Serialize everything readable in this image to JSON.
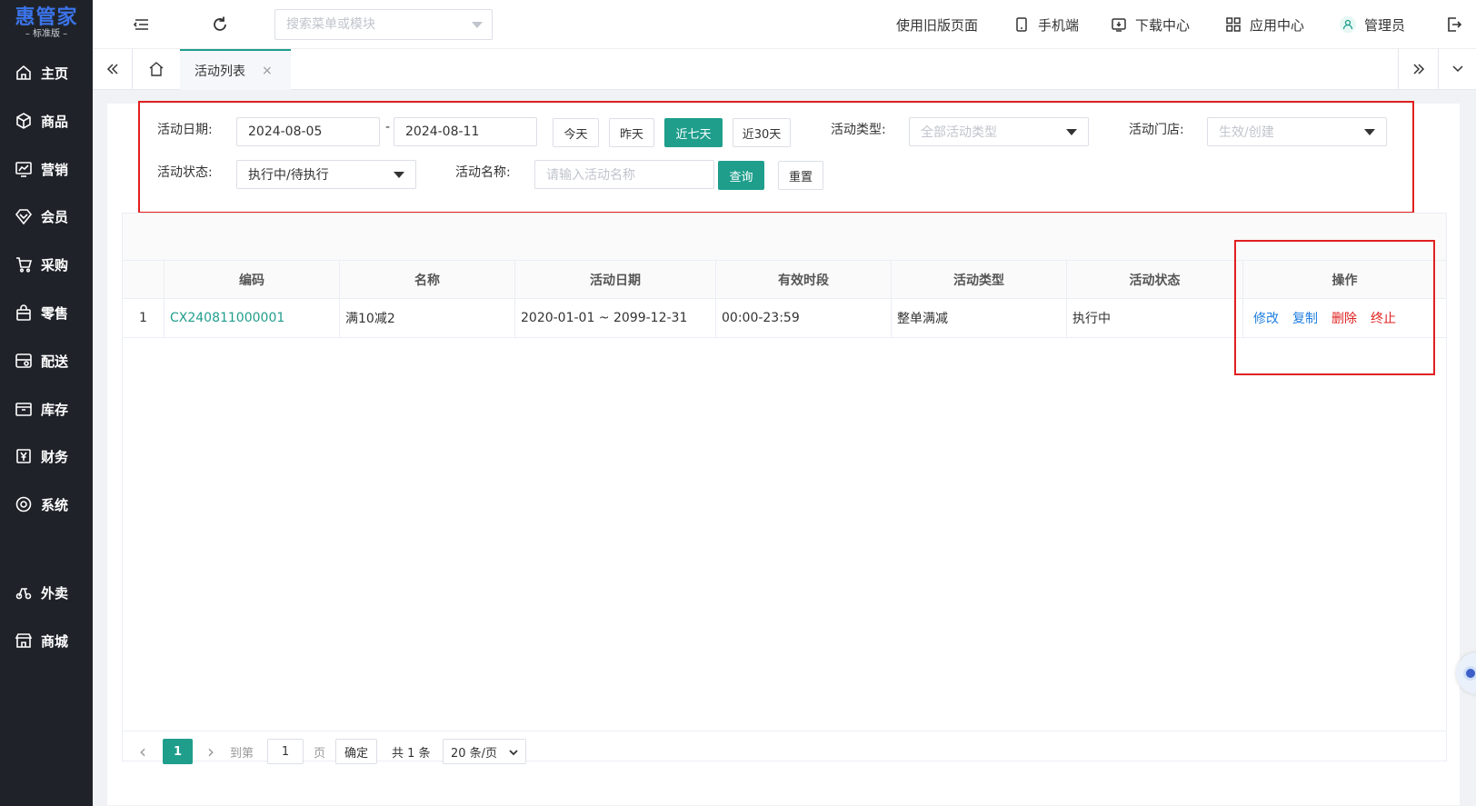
{
  "app": {
    "brand": "惠管家",
    "edition": "– 标准版 –"
  },
  "sidebar": {
    "items": [
      {
        "label": "主页",
        "icon": "home-icon"
      },
      {
        "label": "商品",
        "icon": "box-icon"
      },
      {
        "label": "营销",
        "icon": "chart-icon"
      },
      {
        "label": "会员",
        "icon": "diamond-icon"
      },
      {
        "label": "采购",
        "icon": "cart-icon"
      },
      {
        "label": "零售",
        "icon": "bag-icon"
      },
      {
        "label": "配送",
        "icon": "truck-icon"
      },
      {
        "label": "库存",
        "icon": "archive-icon"
      },
      {
        "label": "财务",
        "icon": "yen-icon"
      },
      {
        "label": "系统",
        "icon": "settings-icon"
      },
      {
        "label": "外卖",
        "icon": "scooter-icon"
      },
      {
        "label": "商城",
        "icon": "store-icon"
      }
    ]
  },
  "topbar": {
    "menu_search_placeholder": "搜索菜单或模块",
    "old_version": "使用旧版页面",
    "mobile": "手机端",
    "downloads": "下载中心",
    "apps": "应用中心",
    "user": "管理员"
  },
  "tabs": {
    "active_label": "活动列表",
    "close": "×"
  },
  "filter": {
    "date_label": "活动日期:",
    "date_start": "2024-08-05",
    "date_sep": "-",
    "date_end": "2024-08-11",
    "btn_today": "今天",
    "btn_yesterday": "昨天",
    "btn_7days": "近七天",
    "btn_30days": "近30天",
    "type_label": "活动类型:",
    "type_value": "全部活动类型",
    "store_label": "活动门店:",
    "store_value": "生效/创建",
    "status_label": "活动状态:",
    "status_value": "执行中/待执行",
    "name_label": "活动名称:",
    "name_placeholder": "请输入活动名称",
    "btn_search": "查询",
    "btn_reset": "重置"
  },
  "table": {
    "columns": [
      "编码",
      "名称",
      "活动日期",
      "有效时段",
      "活动类型",
      "活动状态",
      "操作"
    ],
    "rows": [
      {
        "index": "1",
        "code": "CX240811000001",
        "name": "满10减2",
        "date": "2020-01-01 ~ 2099-12-31",
        "period": "00:00-23:59",
        "type": "整单满减",
        "status": "执行中",
        "actions": {
          "edit": "修改",
          "copy": "复制",
          "delete": "删除",
          "stop": "终止"
        }
      }
    ]
  },
  "pager": {
    "prev": "‹",
    "current": "1",
    "next": "›",
    "goto_label": "到第",
    "goto_value": "1",
    "page_unit": "页",
    "confirm": "确定",
    "total": "共 1 条",
    "page_size": "20 条/页"
  },
  "colors": {
    "accent": "#1f9e8c",
    "sidebar_bg": "#1f2329",
    "link_blue": "#1f7ee0",
    "danger_red": "#e02020",
    "highlight_box": "#e02020"
  }
}
